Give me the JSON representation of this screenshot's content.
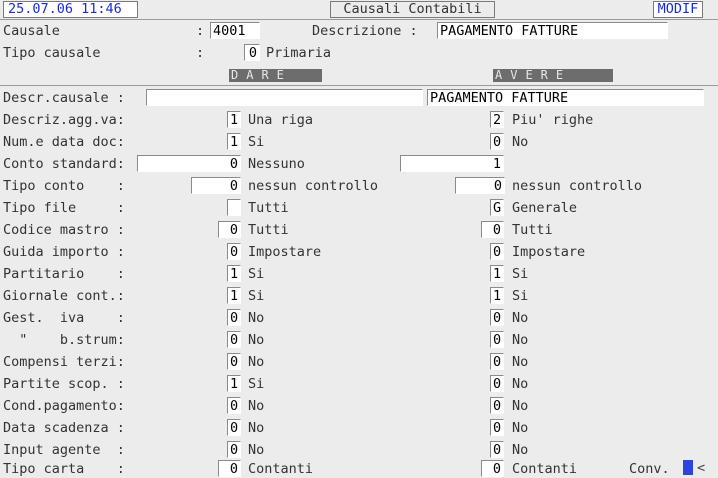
{
  "topbar": {
    "datetime": "25.07.06 11:46",
    "title": "Causali Contabili",
    "mode": "MODIF"
  },
  "form": {
    "causale_label": "Causale",
    "causale_colon": ":",
    "causale_value": "4001",
    "descrizione_label": "Descrizione :",
    "descrizione_value": "PAGAMENTO FATTURE",
    "tipo_label": "Tipo causale",
    "tipo_colon": ":",
    "tipo_value": "0",
    "tipo_text": "Primaria"
  },
  "headers": {
    "dare": "DARE",
    "avere": "AVERE"
  },
  "rows": [
    {
      "label": "Descr.causale :",
      "dare_value": "",
      "avere_value": "PAGAMENTO FATTURE"
    },
    {
      "label": "Descriz.agg.va:",
      "dare_value": "1",
      "dare_text": "Una riga",
      "avere_value": "2",
      "avere_text": "Piu' righe"
    },
    {
      "label": "Num.e data doc:",
      "dare_value": "1",
      "dare_text": "Si",
      "avere_value": "0",
      "avere_text": "No"
    },
    {
      "label": "Conto standard:",
      "dare_value": "0",
      "dare_text": "Nessuno",
      "avere_value": "1",
      "avere_text": ""
    },
    {
      "label": "Tipo conto    :",
      "dare_value": "0",
      "dare_text": "nessun controllo",
      "avere_value": "0",
      "avere_text": "nessun controllo"
    },
    {
      "label": "Tipo file     :",
      "dare_value": "",
      "dare_text": "Tutti",
      "avere_value": "G",
      "avere_text": "Generale"
    },
    {
      "label": "Codice mastro :",
      "dare_value": "0",
      "dare_text": "Tutti",
      "avere_value": "0",
      "avere_text": "Tutti"
    },
    {
      "label": "Guida importo :",
      "dare_value": "0",
      "dare_text": "Impostare",
      "avere_value": "0",
      "avere_text": "Impostare"
    },
    {
      "label": "Partitario    :",
      "dare_value": "1",
      "dare_text": "Si",
      "avere_value": "1",
      "avere_text": "Si"
    },
    {
      "label": "Giornale cont.:",
      "dare_value": "1",
      "dare_text": "Si",
      "avere_value": "1",
      "avere_text": "Si"
    },
    {
      "label": "Gest.  iva    :",
      "dare_value": "0",
      "dare_text": "No",
      "avere_value": "0",
      "avere_text": "No"
    },
    {
      "label": "  \"    b.strum:",
      "dare_value": "0",
      "dare_text": "No",
      "avere_value": "0",
      "avere_text": "No"
    },
    {
      "label": "Compensi terzi:",
      "dare_value": "0",
      "dare_text": "No",
      "avere_value": "0",
      "avere_text": "No"
    },
    {
      "label": "Partite scop. :",
      "dare_value": "1",
      "dare_text": "Si",
      "avere_value": "0",
      "avere_text": "No"
    },
    {
      "label": "Cond.pagamento:",
      "dare_value": "0",
      "dare_text": "No",
      "avere_value": "0",
      "avere_text": "No"
    },
    {
      "label": "Data scadenza :",
      "dare_value": "0",
      "dare_text": "No",
      "avere_value": "0",
      "avere_text": "No"
    },
    {
      "label": "Input agente  :",
      "dare_value": "0",
      "dare_text": "No",
      "avere_value": "0",
      "avere_text": "No"
    },
    {
      "label": "Tipo carta    :",
      "dare_value": "0",
      "dare_text": "Contanti",
      "avere_value": "0",
      "avere_text": "Contanti"
    }
  ],
  "footer": {
    "conv_label": "Conv.",
    "arrow": "<"
  }
}
